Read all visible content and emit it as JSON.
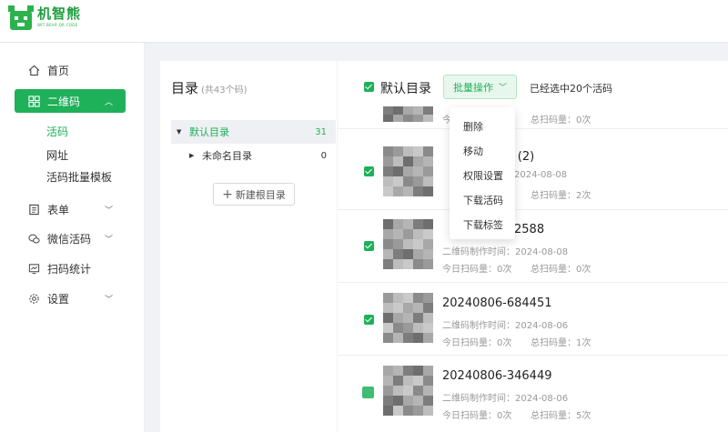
{
  "app": {
    "name": "机智熊",
    "tagline": "WIT BEAR QR CODE",
    "brand_color": "#1fb05a"
  },
  "sidebar": {
    "items": [
      {
        "label": "首页",
        "icon": "home-icon"
      },
      {
        "label": "二维码",
        "icon": "qrcode-icon",
        "active": true
      },
      {
        "label": "表单",
        "icon": "form-icon"
      },
      {
        "label": "微信活码",
        "icon": "wechat-icon"
      },
      {
        "label": "扫码统计",
        "icon": "chart-icon"
      },
      {
        "label": "设置",
        "icon": "gear-icon"
      }
    ],
    "subitems": [
      "活码",
      "网址",
      "活码批量模板"
    ]
  },
  "catalog": {
    "title": "目录",
    "count": "(共43个码)",
    "tree": [
      {
        "label": "默认目录",
        "count": "31"
      },
      {
        "label": "未命名目录",
        "count": "0"
      }
    ],
    "new_root": "新建根目录"
  },
  "main": {
    "dir_title": "默认目录",
    "batch_label": "批量操作",
    "selected_info": "已经选中20个活码",
    "dropdown": [
      "删除",
      "移动",
      "权限设置",
      "下载活码",
      "下载标签"
    ],
    "rows": [
      {
        "name": "",
        "time_label": "",
        "time": "",
        "today": "今",
        "total_label": "总扫码量：",
        "total": "0次"
      },
      {
        "name": "i (2)",
        "time_label": "",
        "time": "2024-08-08",
        "today": "",
        "total_label": "总扫码量：",
        "total": "2次"
      },
      {
        "name": "2588",
        "time_label": "二维码制作时间：",
        "time": "2024-08-08",
        "today_label": "今日扫码量：",
        "today": "0次",
        "total_label": "总扫码量：",
        "total": "0次"
      },
      {
        "name": "20240806-684451",
        "time_label": "二维码制作时间：",
        "time": "2024-08-06",
        "today_label": "今日扫码量：",
        "today": "0次",
        "total_label": "总扫码量：",
        "total": "1次"
      },
      {
        "name": "20240806-346449",
        "time_label": "二维码制作时间：",
        "time": "2024-08-06",
        "today_label": "今日扫码量：",
        "today": "0次",
        "total_label": "总扫码量：",
        "total": "5次"
      }
    ]
  }
}
